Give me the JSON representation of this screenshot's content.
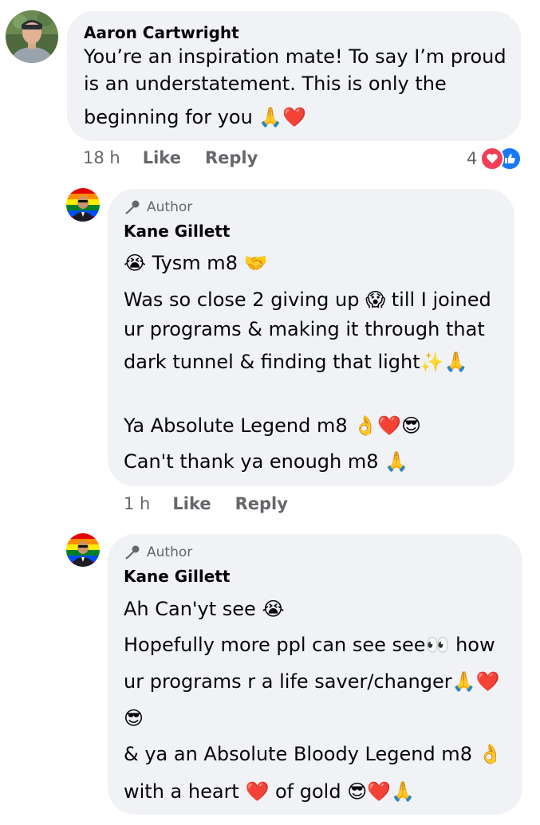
{
  "comments": [
    {
      "author": "Aaron Cartwright",
      "lines": [
        "You’re an inspiration mate! To say I’m proud",
        "is an understatement. This is only the",
        "beginning for you 🙏❤️"
      ],
      "time": "18 h",
      "like_label": "Like",
      "reply_label": "Reply",
      "reaction_count": "4"
    },
    {
      "badge": "Author",
      "author": "Kane Gillett",
      "lines": [
        "😭 Tysm m8 🤝",
        "Was so close 2 giving up 😱 till I joined",
        "ur programs & making it through that",
        "dark tunnel & finding that light✨🙏",
        "Ya Absolute Legend m8 👌❤️😎",
        "Can't thank ya enough m8 🙏"
      ],
      "time": "1 h",
      "like_label": "Like",
      "reply_label": "Reply"
    },
    {
      "badge": "Author",
      "author": "Kane Gillett",
      "lines": [
        "Ah Can'yt see 😭",
        "Hopefully more ppl can see see👀 how",
        "ur programs r a life saver/changer🙏❤️",
        "😎",
        "& ya an Absolute Bloody Legend m8 👌",
        "with a heart ❤️ of gold 😎❤️🙏"
      ]
    }
  ],
  "colors": {
    "bubble": "#f0f2f5",
    "meta_text": "#65676b",
    "love": "#f33e58",
    "like": "#1877f2"
  },
  "icons": [
    "profile-photo",
    "rainbow-avatar",
    "microphone-icon",
    "love-reaction-icon",
    "like-reaction-icon"
  ]
}
